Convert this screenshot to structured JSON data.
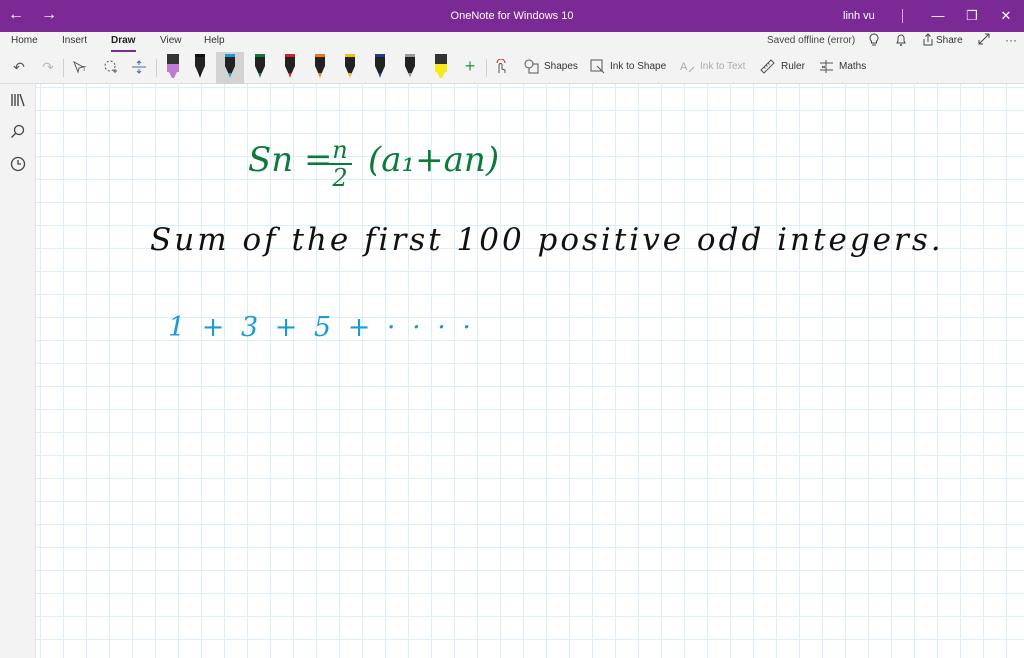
{
  "titlebar": {
    "title": "OneNote for Windows 10",
    "user": "linh vu",
    "back": "←",
    "forward": "→",
    "minimize": "—",
    "maximize": "❐",
    "close": "✕",
    "accent": "#7b2a95"
  },
  "menu": {
    "tabs": [
      "Home",
      "Insert",
      "Draw",
      "View",
      "Help"
    ],
    "active": "Draw",
    "status": "Saved offline (error)",
    "share": "Share"
  },
  "ribbon": {
    "undo": "↶",
    "redo": "↷",
    "add_pen": "+",
    "shapes": "Shapes",
    "ink_to_shape": "Ink to Shape",
    "ink_to_text": "Ink to Text",
    "ruler": "Ruler",
    "maths": "Maths",
    "pens": [
      {
        "name": "pen-purple-highlighter",
        "color": "#c07bd3"
      },
      {
        "name": "pen-black",
        "color": "#111111"
      },
      {
        "name": "pen-blue",
        "color": "#1b9bd6"
      },
      {
        "name": "pen-green",
        "color": "#0c7a3a"
      },
      {
        "name": "pen-red",
        "color": "#d32020"
      },
      {
        "name": "pen-orange",
        "color": "#f07a16"
      },
      {
        "name": "pen-yellow",
        "color": "#f3c20c"
      },
      {
        "name": "pen-navy",
        "color": "#1b3d8f"
      },
      {
        "name": "pen-gray",
        "color": "#9a9a9a"
      },
      {
        "name": "pen-yellow-highlighter",
        "color": "#f5ea17"
      }
    ]
  },
  "left_rail": [
    "notebooks-icon",
    "search-icon",
    "recent-icon"
  ],
  "ink": {
    "formula_left": "Sn = ",
    "formula_num": "n",
    "formula_den": "2",
    "formula_right": "(a₁+an)",
    "question": "Sum  of  the  first  100  positive  odd  integers.",
    "series": "1 + 3 + 5 + · · · ·"
  }
}
